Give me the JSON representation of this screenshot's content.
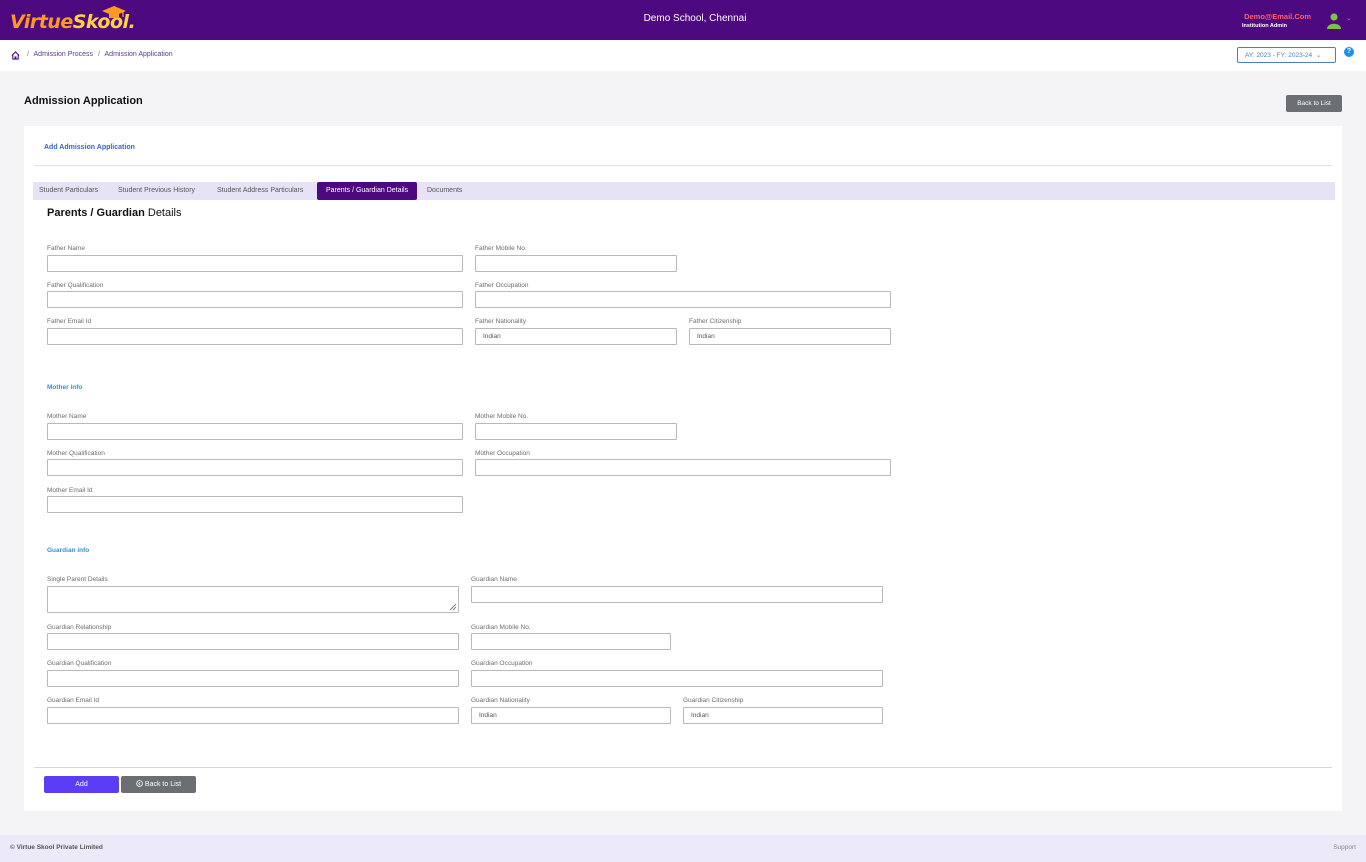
{
  "header": {
    "logo_part1": "Virtue",
    "logo_part2": "Skool",
    "school_name": "Demo School, Chennai",
    "user_email": "Demo@Email.Com",
    "user_role": "Institution Admin",
    "brand_color": "#4d0a80"
  },
  "breadcrumb": {
    "items": [
      "Admission Process",
      "Admission Application"
    ],
    "separator": "/"
  },
  "year_selector": {
    "value": "AY: 2023 - FY: 2023-24"
  },
  "help_label": "?",
  "page": {
    "title": "Admission Application",
    "back_to_list": "Back to List"
  },
  "card": {
    "title": "Add Admission Application"
  },
  "tabs": [
    {
      "label": "Student Particulars",
      "active": false
    },
    {
      "label": "Student Previous History",
      "active": false
    },
    {
      "label": "Student Address Particulars",
      "active": false
    },
    {
      "label": "Parents / Guardian Details",
      "active": true
    },
    {
      "label": "Documents",
      "active": false
    }
  ],
  "section": {
    "title_bold": "Parents / Guardian",
    "title_rest": " Details"
  },
  "father": {
    "name_label": "Father Name",
    "name_value": "",
    "mobile_label": "Father Mobile No.",
    "mobile_value": "",
    "qualification_label": "Father Qualification",
    "qualification_value": "",
    "occupation_label": "Father Occupation",
    "occupation_value": "",
    "email_label": "Father Email Id",
    "email_value": "",
    "nationality_label": "Father Nationality",
    "nationality_value": "Indian",
    "citizenship_label": "Father Citizenship",
    "citizenship_value": "Indian"
  },
  "mother": {
    "heading": "Mother info",
    "name_label": "Mother Name",
    "name_value": "",
    "mobile_label": "Mother Mobile No.",
    "mobile_value": "",
    "qualification_label": "Mother Qualification",
    "qualification_value": "",
    "occupation_label": "Mother Occupation",
    "occupation_value": "",
    "email_label": "Mother Email Id",
    "email_value": ""
  },
  "guardian": {
    "heading": "Guardian info",
    "single_parent_label": "Single Parent Details",
    "single_parent_value": "",
    "name_label": "Guardian Name",
    "name_value": "",
    "relationship_label": "Guardian Relationship",
    "relationship_value": "",
    "mobile_label": "Guardian Mobile No.",
    "mobile_value": "",
    "qualification_label": "Guardian Qualification",
    "qualification_value": "",
    "occupation_label": "Guardian Occupation",
    "occupation_value": "",
    "email_label": "Guardian Email Id",
    "email_value": "",
    "nationality_label": "Guardian Nationality",
    "nationality_value": "Indian",
    "citizenship_label": "Guardian Citizenship",
    "citizenship_value": "Indian"
  },
  "actions": {
    "add_label": "Add",
    "back_label": "Back to List"
  },
  "footer": {
    "copyright": "© Virtue Skool Private Limited",
    "support": "Support"
  }
}
